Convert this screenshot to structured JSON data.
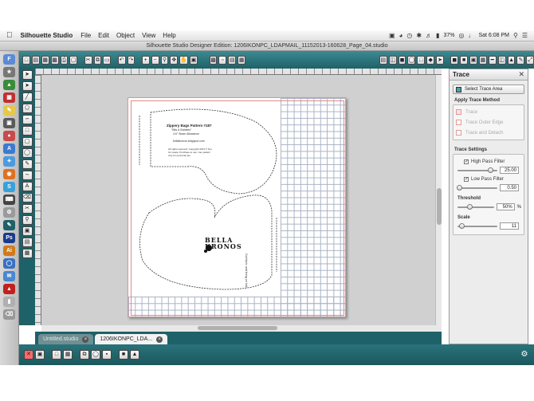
{
  "menubar": {
    "app_name": "Silhouette Studio",
    "items": [
      "File",
      "Edit",
      "Object",
      "View",
      "Help"
    ],
    "battery": "37%",
    "clock": "Sat 6:08 PM"
  },
  "window": {
    "title": "Silhouette Studio Designer Edition: 1206IKONPC_LDAPMAIL_11152013-160628_Page_04.studio"
  },
  "tabs": [
    {
      "label": "Untitled.studio",
      "active": false
    },
    {
      "label": "1206IKONPC_LDA...",
      "active": true
    }
  ],
  "page": {
    "pattern_title": "Zippery Bags Pattern #187",
    "pattern_subtitle": "\"Bits & Bobbles\"",
    "pattern_size": "1/4\" Seam Allowance",
    "pattern_website": "bellakronos.blogspot.com",
    "pattern_notes": "All rights reserved. Copyright 2013 © Not for resale. Purchase to use. Use pattern only for personal use.",
    "side_text_lower": "Cut fabric and lining on fold",
    "logo_line1": "BELLA",
    "logo_line2": "KRONOS"
  },
  "trace_panel": {
    "title": "Trace",
    "select_trace_area": "Select Trace Area",
    "apply_method_label": "Apply Trace Method",
    "methods": [
      "Trace",
      "Trace Outer Edge",
      "Trace and Detach"
    ],
    "settings_label": "Trace Settings",
    "high_pass": {
      "label": "High Pass Filter",
      "checked": true,
      "value": "25.00"
    },
    "low_pass": {
      "label": "Low Pass Filter",
      "checked": true,
      "value": "0.50"
    },
    "threshold": {
      "label": "Threshold",
      "value": "50%",
      "unit": "%"
    },
    "scale": {
      "label": "Scale",
      "value": "11"
    }
  },
  "colors": {
    "toolbar_teal": "#1f6168",
    "cut_line": "#e08a8a",
    "grid": "#a9b3c6"
  }
}
